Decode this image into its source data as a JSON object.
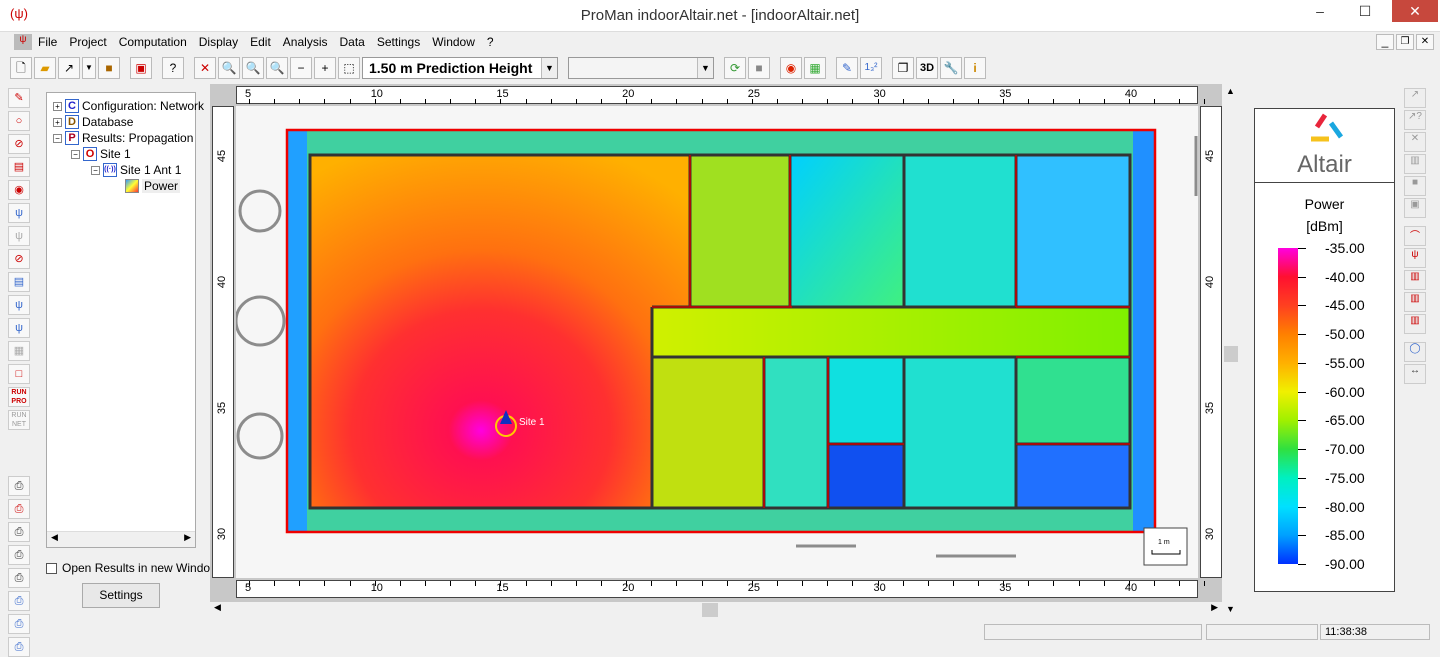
{
  "window": {
    "title": "ProMan indoorAltair.net - [indoorAltair.net]",
    "minimize": "–",
    "maximize": "☐",
    "close": "✕",
    "child_min": "_",
    "child_restore": "❐",
    "child_close": "✕"
  },
  "menu": [
    "File",
    "Project",
    "Computation",
    "Display",
    "Edit",
    "Analysis",
    "Data",
    "Settings",
    "Window",
    "?"
  ],
  "toolbar": {
    "prediction_height": "1.50 m Prediction Height",
    "second_combo": "",
    "btn_3d": "3D",
    "btn_12": "1₃²"
  },
  "tree": {
    "items": [
      {
        "label": "Configuration: Network",
        "icon": "C"
      },
      {
        "label": "Database",
        "icon": "D"
      },
      {
        "label": "Results: Propagation",
        "icon": "P"
      },
      {
        "label": "Site 1",
        "icon": "O"
      },
      {
        "label": "Site 1 Ant 1",
        "icon": "((·))"
      },
      {
        "label": "Power",
        "icon": ""
      }
    ],
    "open_results_label": "Open Results in new Window",
    "settings_button": "Settings"
  },
  "map": {
    "x_ticks": [
      "5",
      "10",
      "15",
      "20",
      "25",
      "30",
      "35",
      "40"
    ],
    "y_ticks": [
      "45",
      "40",
      "35",
      "30"
    ],
    "site_label": "Site 1",
    "scale_label": "1 m"
  },
  "legend": {
    "brand": "Altair",
    "title": "Power",
    "unit": "[dBm]",
    "labels": [
      "-35.00",
      "-40.00",
      "-45.00",
      "-50.00",
      "-55.00",
      "-60.00",
      "-65.00",
      "-70.00",
      "-75.00",
      "-80.00",
      "-85.00",
      "-90.00"
    ],
    "colors": [
      "#ff00e0",
      "#ff1030",
      "#ff4020",
      "#ff8000",
      "#ffb000",
      "#f0f000",
      "#a0f000",
      "#30e040",
      "#00f0c0",
      "#00e0ff",
      "#00a0ff",
      "#0030ff"
    ]
  },
  "status": {
    "time": "11:38:38"
  }
}
